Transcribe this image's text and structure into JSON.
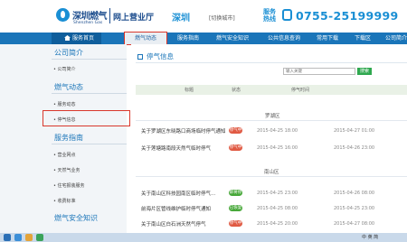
{
  "header": {
    "brand_cn": "深圳燃气",
    "brand_en": "Shenzhen Gas",
    "hall": "网上营业厅",
    "city": "深圳",
    "switch": "[切换城市]",
    "hotline_label": "服务热线",
    "phone": "0755-25199999"
  },
  "nav": {
    "items": [
      "服务首页",
      "燃气动态",
      "服务指南",
      "燃气安全知识",
      "公共信息查询",
      "常用下载",
      "下载区",
      "公司简介"
    ]
  },
  "sidebar": {
    "sections": [
      {
        "title": "公司简介",
        "items": [
          "公司简介"
        ]
      },
      {
        "title": "燃气动态",
        "items": [
          "服务动态",
          "停气信息"
        ]
      },
      {
        "title": "服务指南",
        "items": [
          "营业网点",
          "天然气业务",
          "住宅报装服务",
          "收费标准"
        ]
      },
      {
        "title": "燃气安全知识",
        "items": []
      }
    ]
  },
  "main": {
    "title": "停气信息",
    "search_placeholder": "输入关键",
    "search_button": "搜索",
    "table_headers": [
      "标题",
      "状态",
      "停气时间"
    ],
    "groups": [
      {
        "name": "罗湖区",
        "rows": [
          {
            "title": "关于罗湖区东晓路口商场临时停气通知",
            "status": "停气中",
            "start": "2015-04-25  18:00",
            "end": "2015-04-27  01:00"
          },
          {
            "title": "关于莲塘路南段天然气临时停气",
            "status": "停气中",
            "start": "2015-04-25  16:00",
            "end": "2015-04-26  23:00"
          }
        ]
      },
      {
        "name": "南山区",
        "rows": [
          {
            "title": "关于南山区科技园南区临时停气...",
            "status": "即将停气",
            "start": "2015-04-25  23:00",
            "end": "2015-04-26  08:00"
          },
          {
            "title": "前海片区管线维护临时停气通知",
            "status": "已恢复",
            "start": "2015-04-25  08:00",
            "end": "2015-04-25  23:00"
          },
          {
            "title": "关于南山区白石洲天然气停气",
            "status": "停气中",
            "start": "2015-04-25  20:00",
            "end": "2015-04-27  08:00"
          }
        ]
      }
    ]
  },
  "taskbar": {
    "tray_text": "中 英 简"
  },
  "colors": {
    "brand_blue": "#1a75b9",
    "accent_blue": "#1a8fd4",
    "highlight_red": "#d9382c",
    "badge_red": "#e05a43",
    "badge_green": "#48a83a"
  }
}
